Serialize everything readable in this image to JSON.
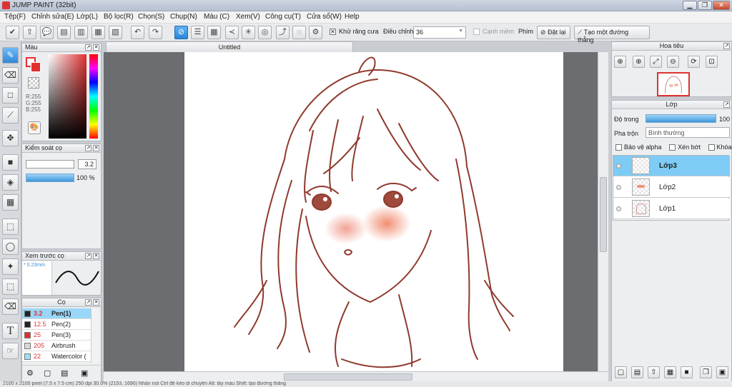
{
  "window": {
    "title": "JUMP PAINT (32bit)",
    "min_glyph": "▁",
    "max_glyph": "❐",
    "close_glyph": "✕"
  },
  "menu": [
    "Tệp(F)",
    "Chỉnh sửa(E)",
    "Lớp(L)",
    "Bộ lọc(R)",
    "Chọn(S)",
    "Chụp(N)",
    "Màu (C)",
    "Xem(V)",
    "Công cụ(T)",
    "Cửa sổ(W)",
    "Help"
  ],
  "toolbar": {
    "icons": [
      "✔",
      "⇧",
      "💬",
      "▤",
      "▥",
      "▦",
      "▧",
      "↶",
      "↷",
      "⊘",
      "☰",
      "▦",
      "≺",
      "✳",
      "◎",
      "⤴",
      "◌",
      "⚙"
    ],
    "antialias_label": "Khử răng cưa",
    "antialias_checked": "✕",
    "adjust_label": "Điều chỉnh",
    "adjust_value": "36",
    "edge_label": "Cạnh mềm",
    "shortcut_label": "Phím",
    "reset_label": "Đặt lại",
    "reset_icon": "⊘",
    "line_label": "Tạo một đường thẳng",
    "line_icon": "⟋"
  },
  "tools": [
    "✎",
    "⌫",
    "□",
    "⟋",
    "✥",
    "■",
    "◈",
    "▦",
    "⬚",
    "◯",
    "✦",
    "⬚",
    "⌫",
    "T",
    "☞"
  ],
  "color_panel": {
    "title": "Màu",
    "r": "R:255",
    "g": "G:255",
    "b": "B:255",
    "palette_icon": "🎨"
  },
  "brush_control": {
    "title": "Kiểm soát cọ",
    "size_value": "3.2",
    "opacity_value": "100 %",
    "opacity_fraction": 1.0
  },
  "brush_preview": {
    "title": "Xem trước cọ",
    "size_label": "* 0.23mm"
  },
  "brushes": {
    "title": "Cọ",
    "items": [
      {
        "size": "3.2",
        "name": "Pen(1)",
        "color": "#222222"
      },
      {
        "size": "12.5",
        "name": "Pen(2)",
        "color": "#222222"
      },
      {
        "size": "25",
        "name": "Pen(3)",
        "color": "#e23030"
      },
      {
        "size": "205",
        "name": "Airbrush",
        "color": "#d8d8d8"
      },
      {
        "size": "22",
        "name": "Watercolor (",
        "color": "#9fe0f5"
      }
    ],
    "footer_icons": [
      "⚙",
      "▢",
      "▤",
      "▣"
    ]
  },
  "document": {
    "tab": "Untitled"
  },
  "navigator": {
    "title": "Hoa tiêu",
    "icons": [
      "⊕",
      "⊕",
      "⤢",
      "⊖",
      "⟳",
      "⊡"
    ]
  },
  "layers": {
    "title": "Lớp",
    "opacity_label": "Độ trong",
    "opacity_value": "100 %",
    "opacity_fraction": 1.0,
    "blend_label": "Pha trộn",
    "blend_value": "Bình thường",
    "protect_alpha": "Bảo vệ alpha",
    "clipping": "Xén bớt",
    "lock": "Khóa",
    "items": [
      {
        "name": "Lớp3",
        "active": true
      },
      {
        "name": "Lớp2",
        "active": false
      },
      {
        "name": "Lớp1",
        "active": false
      }
    ],
    "footer_icons": [
      "▢",
      "▤",
      "⇧",
      "▦",
      "■",
      "❐",
      "▣"
    ]
  },
  "status": "2100 x 2100 pixel  (7.5 x 7.5 cm)  250 dpi  30.0%  (2153, 1690)  Nhấn nút Ctrl để kéo di chuyển  Alt: lấy màu  Shift: tạo đường thẳng"
}
